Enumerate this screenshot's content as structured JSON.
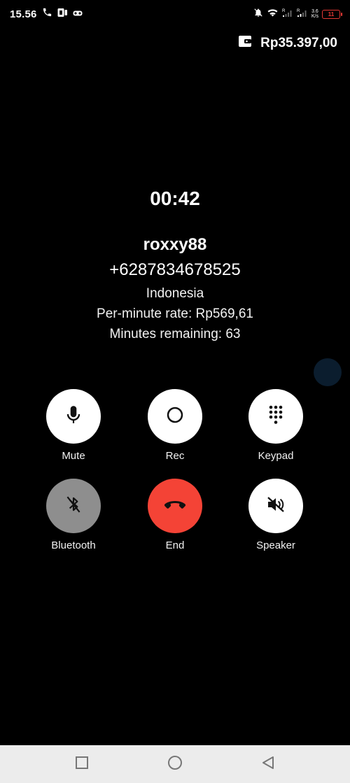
{
  "status_bar": {
    "time": "15.56",
    "network_speed_value": "3.6",
    "network_speed_unit": "K/s",
    "battery_level": "11",
    "signal_roaming_label": "R"
  },
  "balance": {
    "amount": "Rp35.397,00",
    "icon": "wallet-icon"
  },
  "call": {
    "timer": "00:42",
    "name": "roxxy88",
    "number": "+6287834678525",
    "country": "Indonesia",
    "rate": "Per-minute rate: Rp569,61",
    "remaining": "Minutes remaining: 63"
  },
  "controls": {
    "mute": "Mute",
    "rec": "Rec",
    "keypad": "Keypad",
    "bluetooth": "Bluetooth",
    "end": "End",
    "speaker": "Speaker"
  },
  "colors": {
    "background": "#000000",
    "button": "#ffffff",
    "bluetooth_button": "#8e8e8e",
    "end_button": "#f44336",
    "navbar": "#ececec",
    "battery": "#e53935"
  }
}
